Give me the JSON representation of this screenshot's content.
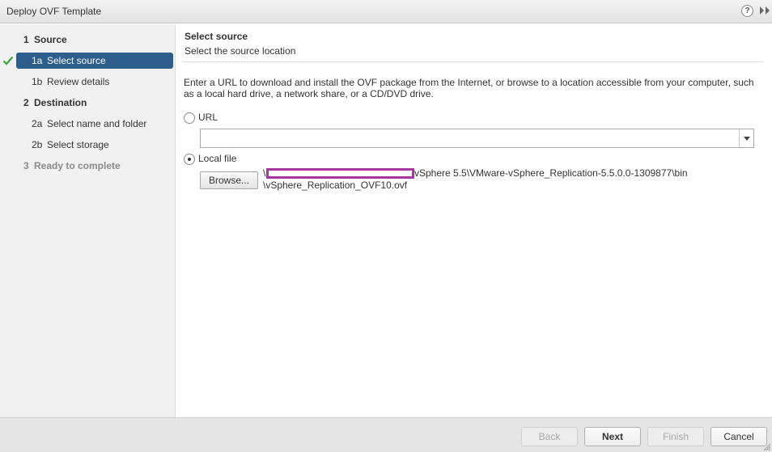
{
  "window": {
    "title": "Deploy OVF Template",
    "help_glyph": "?",
    "expand_icon": "double-chevron-right-icon"
  },
  "sidebar": {
    "steps": [
      {
        "num": "1",
        "label": "Source",
        "level": "head",
        "state": "normal"
      },
      {
        "num": "1a",
        "label": "Select source",
        "level": "sub",
        "state": "selected",
        "completed": true
      },
      {
        "num": "1b",
        "label": "Review details",
        "level": "sub",
        "state": "normal"
      },
      {
        "num": "2",
        "label": "Destination",
        "level": "head",
        "state": "normal"
      },
      {
        "num": "2a",
        "label": "Select name and folder",
        "level": "sub",
        "state": "normal"
      },
      {
        "num": "2b",
        "label": "Select storage",
        "level": "sub",
        "state": "normal"
      },
      {
        "num": "3",
        "label": "Ready to complete",
        "level": "head",
        "state": "disabled"
      }
    ]
  },
  "main": {
    "title": "Select source",
    "subtitle": "Select the source location",
    "description": "Enter a URL to download and install the OVF package from the Internet, or browse to a location accessible from your computer, such as a local hard drive, a network share, or a CD/DVD drive.",
    "url_option": {
      "label": "URL",
      "selected": false,
      "value": ""
    },
    "local_option": {
      "label": "Local file",
      "selected": true
    },
    "browse_label": "Browse...",
    "file_path_prefix": "\\",
    "file_path_line1": "vSphere 5.5\\VMware-vSphere_Replication-5.5.0.0-1309877\\bin",
    "file_path_line2": "\\vSphere_Replication_OVF10.ovf"
  },
  "footer": {
    "back": "Back",
    "next": "Next",
    "finish": "Finish",
    "cancel": "Cancel"
  },
  "colors": {
    "selected_step": "#2e5e8e",
    "check": "#3aa13a",
    "redaction": "#a53a9c"
  }
}
